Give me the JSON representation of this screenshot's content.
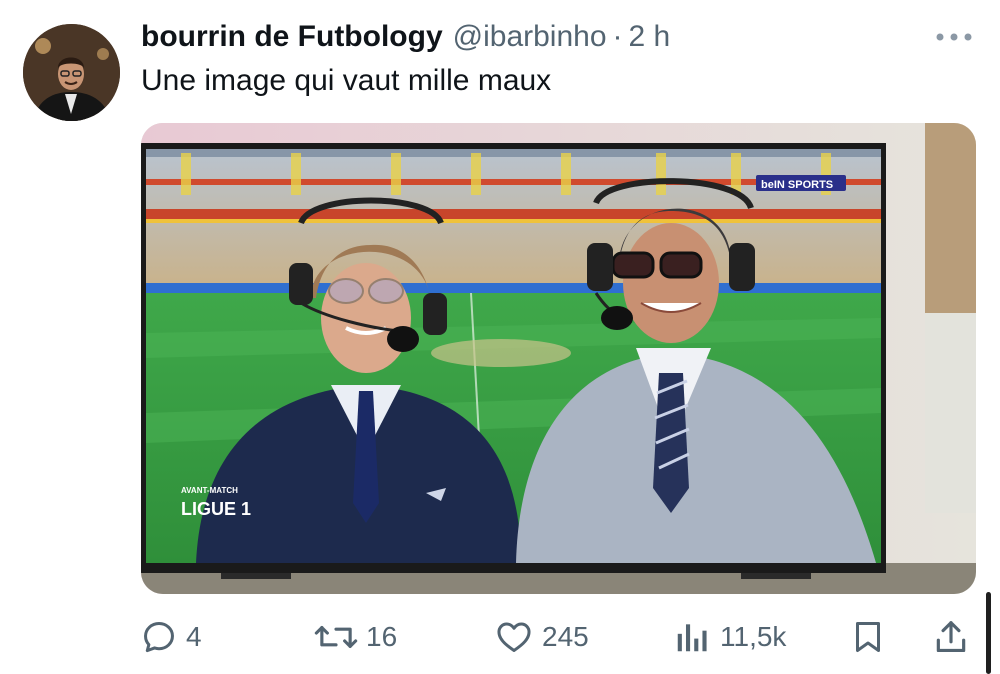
{
  "tweet": {
    "display_name": "bourrin de Futbology",
    "handle": "@ibarbinho",
    "separator": "·",
    "time": "2 h",
    "text": "Une image qui vaut mille maux",
    "more_icon": "more-horizontal-icon"
  },
  "media": {
    "description_icon": "tv-photo",
    "overlay_badge_small": "AVANT-MATCH",
    "overlay_badge_main": "LIGUE 1",
    "broadcaster": "beIN SPORTS"
  },
  "actions": {
    "reply": {
      "icon": "reply-icon",
      "count": "4"
    },
    "retweet": {
      "icon": "retweet-icon",
      "count": "16"
    },
    "like": {
      "icon": "heart-icon",
      "count": "245"
    },
    "views": {
      "icon": "views-icon",
      "count": "11,5k"
    },
    "bookmark": {
      "icon": "bookmark-icon"
    },
    "share": {
      "icon": "share-icon"
    }
  },
  "colors": {
    "text_primary": "#0f1419",
    "text_secondary": "#536471"
  }
}
